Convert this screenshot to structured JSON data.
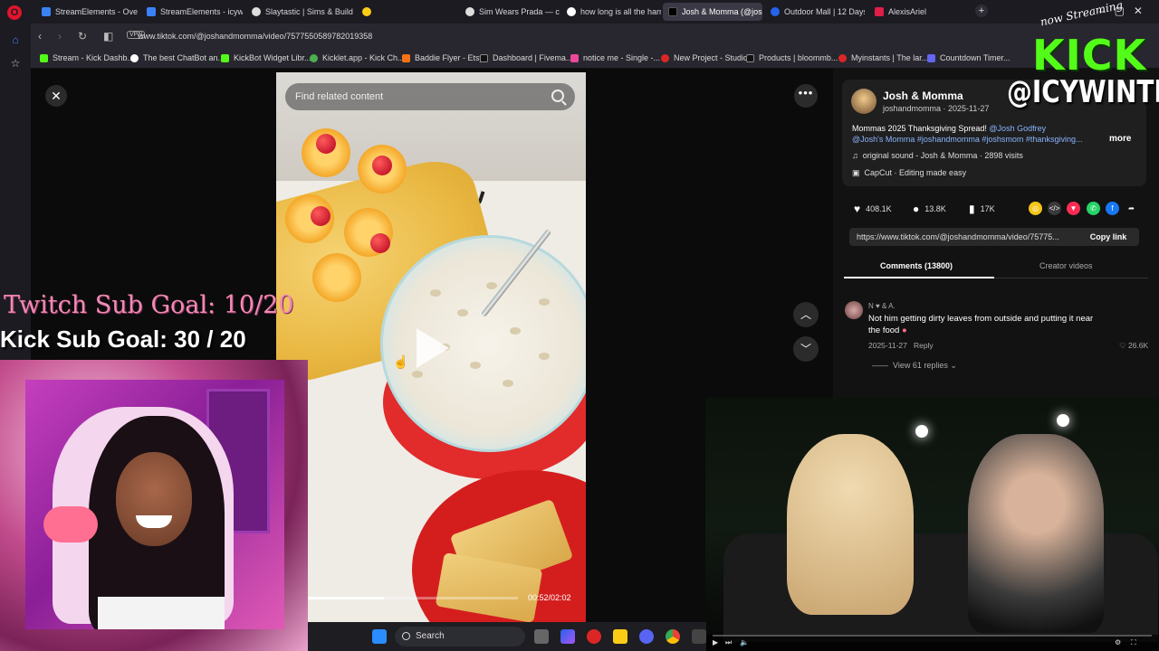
{
  "browser": {
    "tabs": [
      {
        "label": "StreamElements - Overlay",
        "color": "#3b82f6"
      },
      {
        "label": "StreamElements - icywintr",
        "color": "#3b82f6"
      },
      {
        "label": "Slaytastic | Sims & Builds",
        "color": "#f5f5f5"
      },
      {
        "label": "",
        "color": "#f5f5f5"
      },
      {
        "label": "Sim Wears Prada — creat",
        "color": "#f5f5f5"
      },
      {
        "label": "how long is all the harry p",
        "color": "#ffffff"
      },
      {
        "label": "Josh & Momma (@joshan",
        "color": "#000000"
      },
      {
        "label": "Outdoor Mall | 12 Days O",
        "color": "#2563eb"
      },
      {
        "label": "AlexisAriel",
        "color": "#e11d48"
      }
    ],
    "url": "www.tiktok.com/@joshandmomma/video/7577550589782019358",
    "vpn": "VPN",
    "bookmarks": [
      {
        "label": "Stream - Kick Dashb...",
        "color": "#53fc18"
      },
      {
        "label": "The best ChatBot an...",
        "color": "#ffffff"
      },
      {
        "label": "KickBot Widget Libr...",
        "color": "#53fc18"
      },
      {
        "label": "Kicklet.app - Kick Ch...",
        "color": "#4caf50"
      },
      {
        "label": "Baddie Flyer - Etsy",
        "color": "#f97316"
      },
      {
        "label": "Dashboard | Fivema...",
        "color": "#111111"
      },
      {
        "label": "notice me - Single -...",
        "color": "#ec4899"
      },
      {
        "label": "New Project - Studio",
        "color": "#dc2626"
      },
      {
        "label": "Products | bloommb...",
        "color": "#111111"
      },
      {
        "label": "Myinstants | The lar...",
        "color": "#dc2626"
      },
      {
        "label": "Countdown Timer...",
        "color": "#6366f1"
      }
    ]
  },
  "tiktok": {
    "search_placeholder": "Find related content",
    "timecode": "00:52/02:02",
    "progress_fraction": 0.36,
    "author": "Josh & Momma",
    "handle": "joshandmomma · 2025-11-27",
    "desc_line1": "Mommas 2025 Thanksgiving Spread! ",
    "desc_mention": "@Josh Godfrey",
    "desc_line2": "@Josh's Momma #joshandmomma #joshsmom #thanksgiving...",
    "more": "more",
    "sound": "original sound - Josh & Momma · 2898 visits",
    "capcut": "CapCut · Editing made easy",
    "likes": "408.1K",
    "comments_count": "13.8K",
    "saves": "17K",
    "link": "https://www.tiktok.com/@joshandmomma/video/75775...",
    "copy_link": "Copy link",
    "tab_comments": "Comments (13800)",
    "tab_creator": "Creator videos",
    "comment": {
      "name": "N ♥ & A.",
      "text": "Not him getting dirty leaves from outside and putting it near the food",
      "date": "2025-11-27",
      "reply": "Reply",
      "likes": "26.6K",
      "view_replies": "View 61 replies"
    }
  },
  "overlay": {
    "twitch_goal": "Twitch Sub Goal: 10/20",
    "kick_goal": "Kick Sub Goal: 30 / 20",
    "now_streaming": "now Streaming",
    "kick_logo": "KICK",
    "kick_handle": "@ICYWINTRR"
  },
  "taskbar": {
    "search": "Search"
  },
  "colors": {
    "kick_green": "#53fc18",
    "tiktok_link": "#8ab4ff"
  }
}
